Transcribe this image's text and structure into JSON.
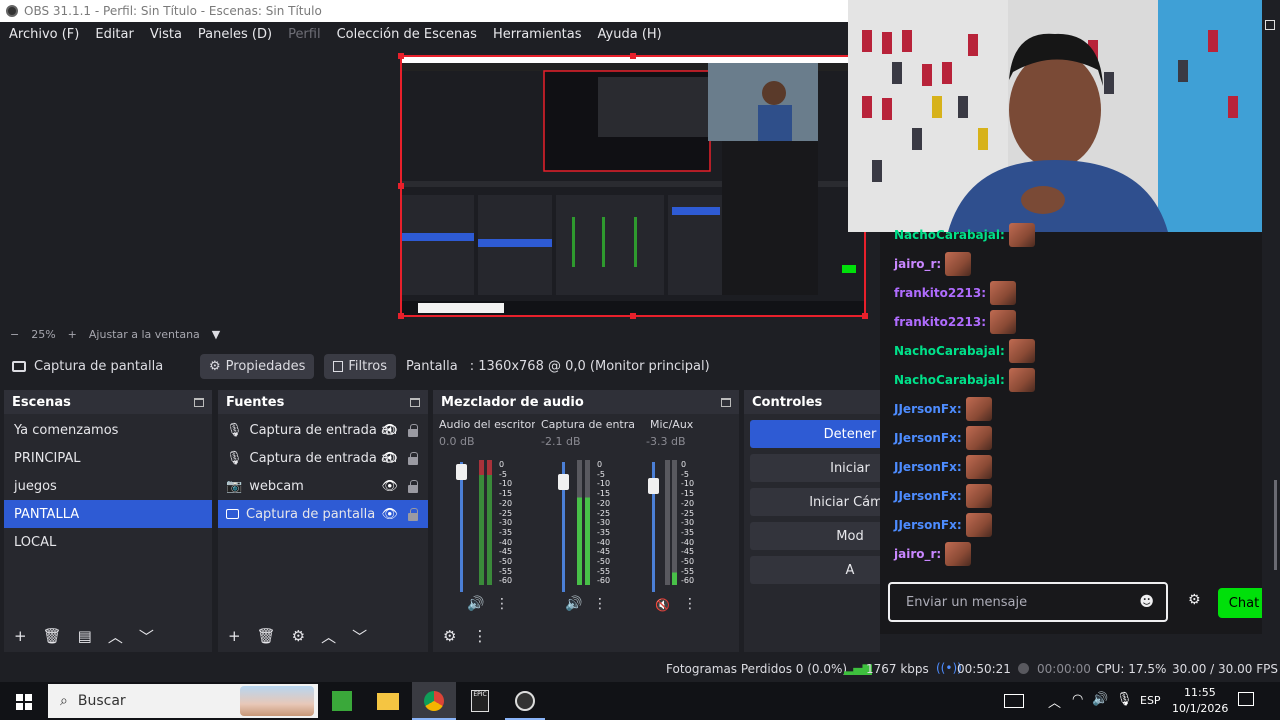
{
  "window": {
    "title": "OBS 31.1.1 - Perfil: Sin Título - Escenas: Sin Título"
  },
  "menu": [
    "Archivo (F)",
    "Editar",
    "Vista",
    "Paneles (D)",
    "Perfil",
    "Colección de Escenas",
    "Herramientas",
    "Ayuda (H)"
  ],
  "zoom": {
    "minus": "−",
    "value": "25%",
    "plus": "+",
    "fit": "Ajustar a la ventana"
  },
  "source_bar": {
    "selected_source": "Captura de pantalla",
    "properties": "Propiedades",
    "filters": "Filtros",
    "display_label": "Pantalla",
    "display_value": ": 1360x768 @ 0,0 (Monitor principal)"
  },
  "scenes": {
    "title": "Escenas",
    "items": [
      "Ya comenzamos",
      "PRINCIPAL",
      "juegos",
      "PANTALLA",
      "LOCAL"
    ],
    "selected": "PANTALLA"
  },
  "sources": {
    "title": "Fuentes",
    "items": [
      "Captura de entrada au",
      "Captura de entrada au",
      "webcam",
      "Captura de pantalla"
    ]
  },
  "mixer": {
    "title": "Mezclador de audio",
    "channels": [
      {
        "name": "Audio del escritorio",
        "db": "0.0 dB"
      },
      {
        "name": "Captura de entrada",
        "db": "-2.1 dB"
      },
      {
        "name": "Mic/Aux",
        "db": "-3.3 dB"
      }
    ],
    "scale": [
      "0",
      "-5",
      "-10",
      "-15",
      "-20",
      "-25",
      "-30",
      "-35",
      "-40",
      "-45",
      "-50",
      "-55",
      "-60"
    ]
  },
  "controls": {
    "title": "Controles",
    "buttons": [
      "Detener",
      "Iniciar",
      "Iniciar Cáma",
      "Mod",
      "A"
    ]
  },
  "status": {
    "dropped": "Fotogramas Perdidos 0 (0.0%)",
    "bitrate": "1767 kbps",
    "stream_time": "00:50:21",
    "rec_time": "00:00:00",
    "cpu": "CPU: 17.5%",
    "fps": "30.00 / 30.00 FPS"
  },
  "chat": {
    "messages": [
      {
        "user": "NachoCarabajal:",
        "color": "#00e08a"
      },
      {
        "user": "jairo_r:",
        "color": "#c987ff"
      },
      {
        "user": "frankito2213:",
        "color": "#b06cff"
      },
      {
        "user": "frankito2213:",
        "color": "#b06cff"
      },
      {
        "user": "NachoCarabajal:",
        "color": "#00e08a"
      },
      {
        "user": "NachoCarabajal:",
        "color": "#00e08a"
      },
      {
        "user": "JJersonFx:",
        "color": "#4d8cff"
      },
      {
        "user": "JJersonFx:",
        "color": "#4d8cff"
      },
      {
        "user": "JJersonFx:",
        "color": "#4d8cff"
      },
      {
        "user": "JJersonFx:",
        "color": "#4d8cff"
      },
      {
        "user": "JJersonFx:",
        "color": "#4d8cff"
      },
      {
        "user": "jairo_r:",
        "color": "#c987ff"
      }
    ],
    "input_placeholder": "Enviar un mensaje",
    "send_label": "Chat"
  },
  "taskbar": {
    "search_placeholder": "Buscar",
    "lang": "ESP",
    "time": "11:55",
    "date": "10/1/2026"
  },
  "colors": {
    "accent": "#2e5bd4",
    "chat_send": "#00e00a",
    "preview_border": "#e8202b"
  }
}
